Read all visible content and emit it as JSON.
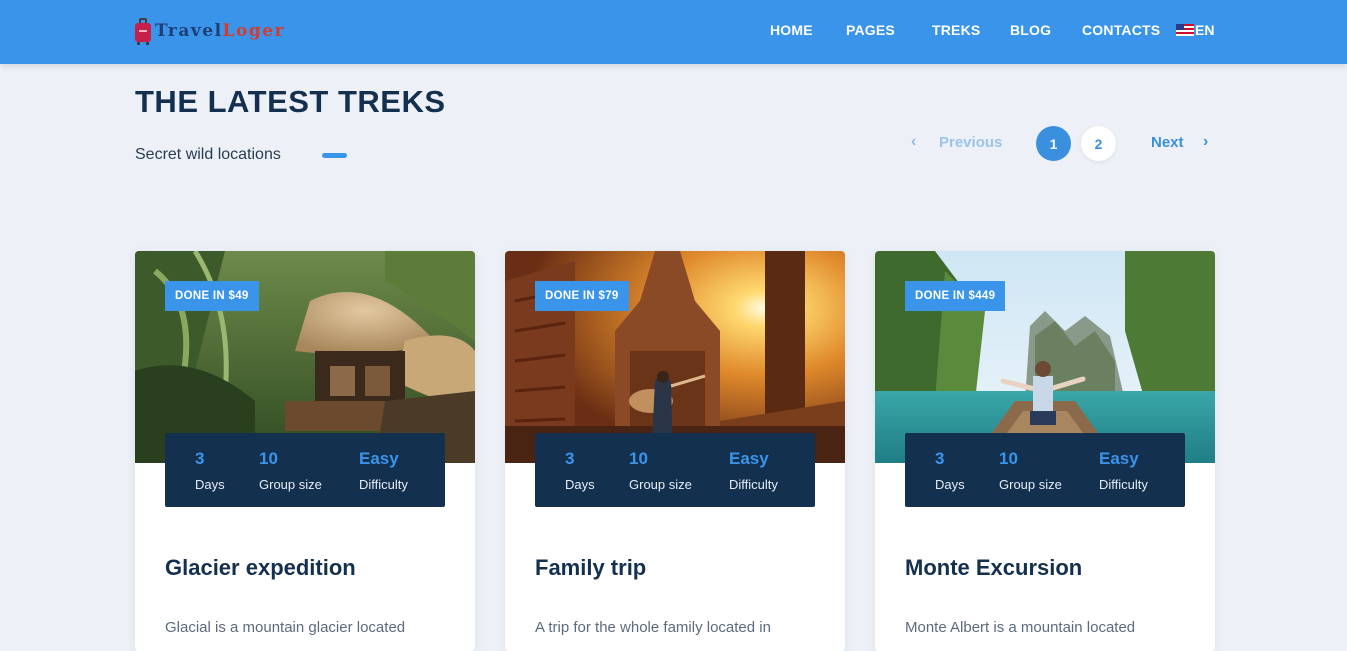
{
  "header": {
    "logo_part1": "Travel",
    "logo_part2": "Loger",
    "nav": [
      "HOME",
      "PAGES",
      "TREKS",
      "BLOG",
      "CONTACTS"
    ],
    "language": "EN"
  },
  "section": {
    "title": "THE LATEST TREKS",
    "subtitle": "Secret wild locations"
  },
  "pagination": {
    "previous": "Previous",
    "next": "Next",
    "pages": [
      "1",
      "2"
    ],
    "current_page": "1"
  },
  "colors": {
    "primary": "#3a95ea",
    "navy": "#14304f",
    "background": "#edf1f7"
  },
  "treks": [
    {
      "badge": "DONE IN $49",
      "days": "3",
      "days_label": "Days",
      "group": "10",
      "group_label": "Group size",
      "difficulty": "Easy",
      "difficulty_label": "Difficulty",
      "title": "Glacier expedition",
      "description": "Glacial is a mountain glacier located"
    },
    {
      "badge": "DONE IN $79",
      "days": "3",
      "days_label": "Days",
      "group": "10",
      "group_label": "Group size",
      "difficulty": "Easy",
      "difficulty_label": "Difficulty",
      "title": "Family trip",
      "description": "A trip for the whole family located in"
    },
    {
      "badge": "DONE IN $449",
      "days": "3",
      "days_label": "Days",
      "group": "10",
      "group_label": "Group size",
      "difficulty": "Easy",
      "difficulty_label": "Difficulty",
      "title": "Monte Excursion",
      "description": "Monte Albert is a mountain located"
    }
  ]
}
